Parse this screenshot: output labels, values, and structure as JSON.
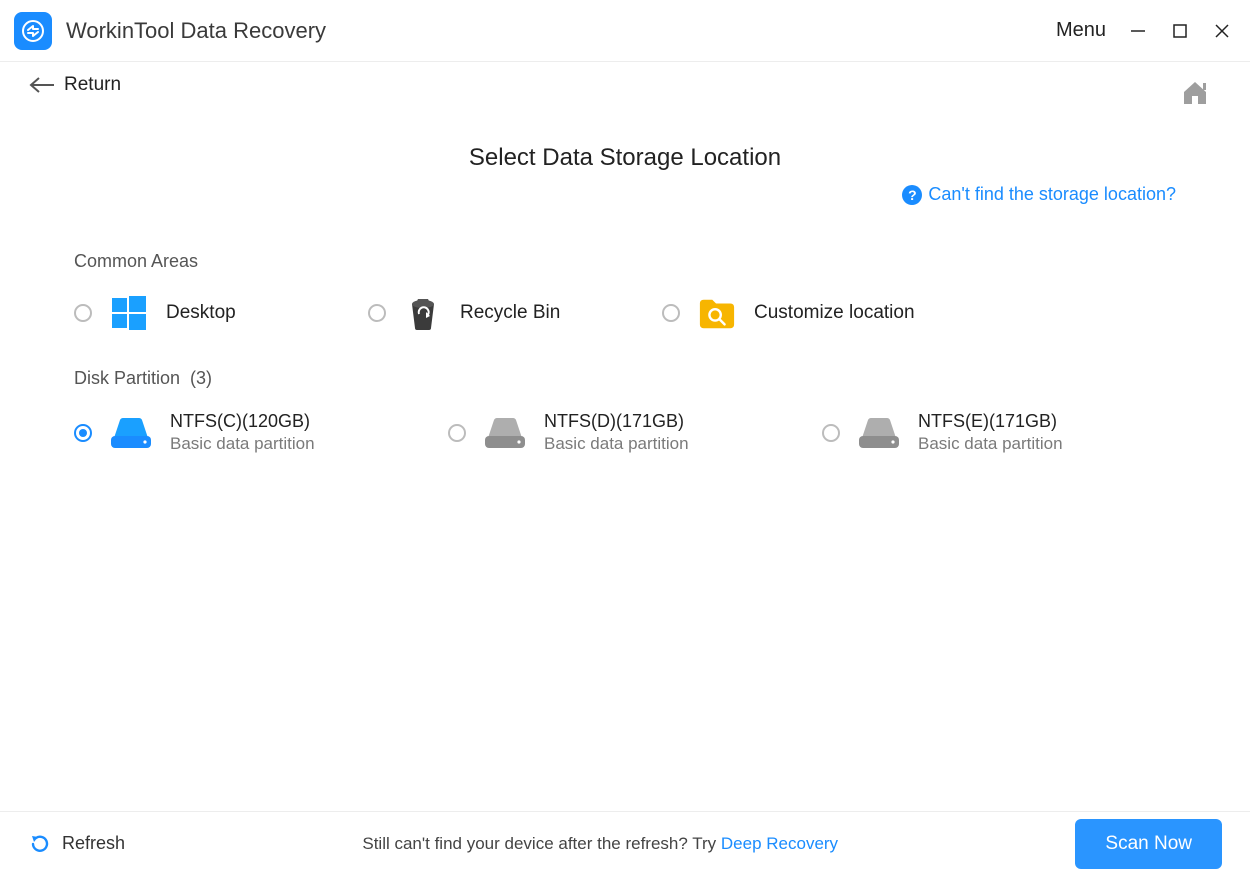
{
  "titlebar": {
    "app_name": "WorkinTool Data Recovery",
    "menu_label": "Menu"
  },
  "subbar": {
    "return_label": "Return"
  },
  "main": {
    "page_title": "Select Data Storage Location",
    "help_link": "Can't find the storage location?",
    "common_section_label": "Common Areas",
    "common_options": [
      {
        "label": "Desktop"
      },
      {
        "label": "Recycle Bin"
      },
      {
        "label": "Customize location"
      }
    ],
    "partition_section_label": "Disk Partition",
    "partition_count": "(3)",
    "partitions": [
      {
        "title": "NTFS(C)(120GB)",
        "subtitle": "Basic data partition",
        "selected": true
      },
      {
        "title": "NTFS(D)(171GB)",
        "subtitle": "Basic data partition",
        "selected": false
      },
      {
        "title": "NTFS(E)(171GB)",
        "subtitle": "Basic data partition",
        "selected": false
      }
    ]
  },
  "footer": {
    "refresh_label": "Refresh",
    "hint_prefix": "Still can't find your device after the refresh? Try ",
    "deep_recovery_label": "Deep Recovery",
    "scan_label": "Scan Now"
  }
}
